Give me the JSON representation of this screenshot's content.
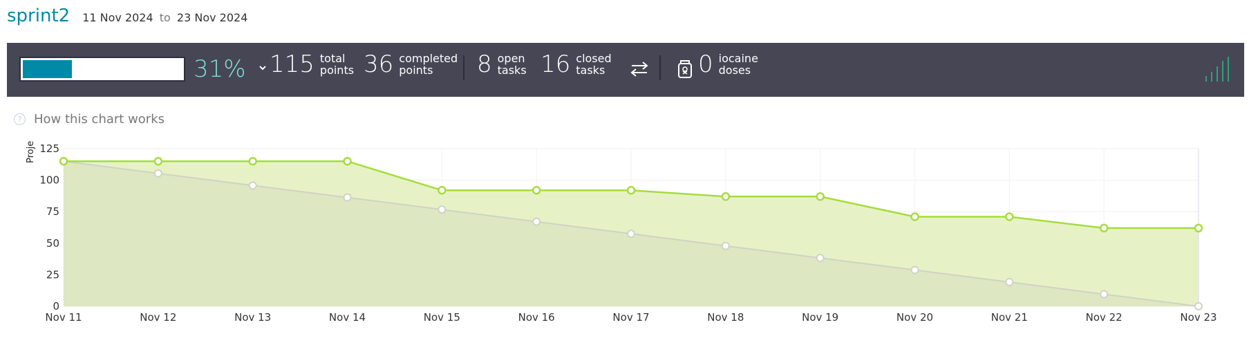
{
  "sprint": {
    "name": "sprint2",
    "start": "11 Nov 2024",
    "to": "to",
    "end": "23 Nov 2024"
  },
  "summary": {
    "progress_fraction": 0.31,
    "percent": "31%",
    "total_points": "115",
    "total_label_1": "total",
    "total_label_2": "points",
    "completed_points": "36",
    "completed_label_1": "completed",
    "completed_label_2": "points",
    "open_tasks": "8",
    "open_label_1": "open",
    "open_label_2": "tasks",
    "closed_tasks": "16",
    "closed_label_1": "closed",
    "closed_label_2": "tasks",
    "iocaine_doses": "0",
    "iocaine_label_1": "iocaine",
    "iocaine_label_2": "doses"
  },
  "help": {
    "how_chart_works": "How this chart works"
  },
  "colors": {
    "accent": "#008aa8",
    "percent": "#7fe0d6",
    "bar_bg": "#464655",
    "real_line": "#a6dc3d",
    "real_fill": "#e6f2c6",
    "ideal_line": "#cfd3c4",
    "ideal_fill": "#dde7c1"
  },
  "chart_data": {
    "type": "line",
    "ylabel": "Proje",
    "categories": [
      "Nov 11",
      "Nov 12",
      "Nov 13",
      "Nov 14",
      "Nov 15",
      "Nov 16",
      "Nov 17",
      "Nov 18",
      "Nov 19",
      "Nov 20",
      "Nov 21",
      "Nov 22",
      "Nov 23"
    ],
    "yticks": [
      0,
      25,
      50,
      75,
      100,
      125
    ],
    "ylim": [
      0,
      125
    ],
    "grid": true,
    "series": [
      {
        "key": "real",
        "values": [
          115,
          115,
          115,
          115,
          92,
          92,
          92,
          87,
          87,
          71,
          71,
          62,
          62
        ]
      },
      {
        "key": "ideal",
        "values": [
          115,
          105.4,
          95.8,
          86.3,
          76.7,
          67.1,
          57.5,
          47.9,
          38.3,
          28.8,
          19.2,
          9.6,
          0
        ]
      }
    ]
  }
}
